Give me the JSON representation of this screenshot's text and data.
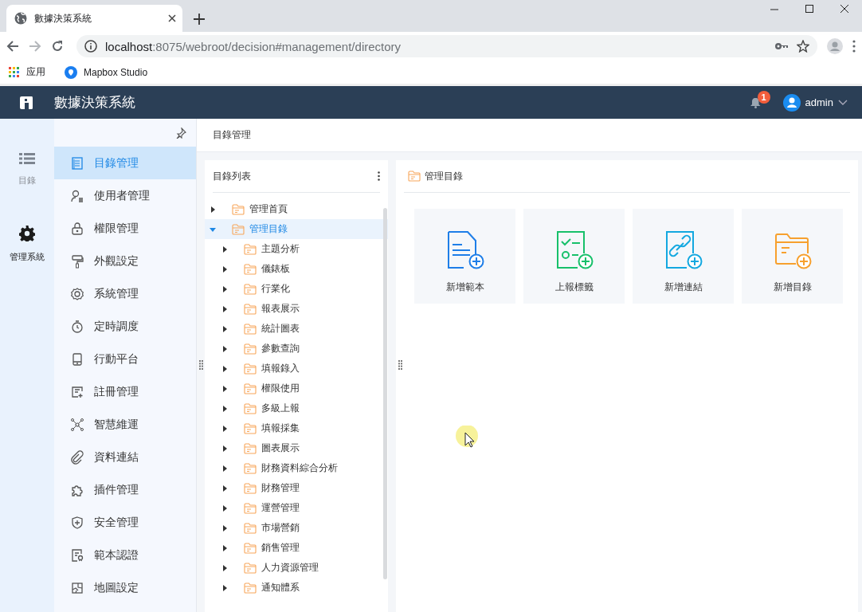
{
  "browser": {
    "tab_title": "數據決策系統",
    "url_host": "localhost",
    "url_rest": ":8075/webroot/decision#management/directory",
    "bookmarks": [
      {
        "label": "应用"
      },
      {
        "label": "Mapbox Studio"
      }
    ]
  },
  "header": {
    "title": "數據決策系統",
    "notification_count": "1",
    "user": "admin"
  },
  "rail": [
    {
      "label": "目錄",
      "selected": false
    },
    {
      "label": "管理系統",
      "selected": true
    }
  ],
  "nav": [
    {
      "label": "目錄管理",
      "selected": true
    },
    {
      "label": "使用者管理",
      "selected": false
    },
    {
      "label": "權限管理",
      "selected": false
    },
    {
      "label": "外觀設定",
      "selected": false
    },
    {
      "label": "系統管理",
      "selected": false
    },
    {
      "label": "定時調度",
      "selected": false
    },
    {
      "label": "行動平台",
      "selected": false
    },
    {
      "label": "註冊管理",
      "selected": false
    },
    {
      "label": "智慧維運",
      "selected": false
    },
    {
      "label": "資料連結",
      "selected": false
    },
    {
      "label": "插件管理",
      "selected": false
    },
    {
      "label": "安全管理",
      "selected": false
    },
    {
      "label": "範本認證",
      "selected": false
    },
    {
      "label": "地圖設定",
      "selected": false
    }
  ],
  "breadcrumb": "目錄管理",
  "tree": {
    "title": "目錄列表",
    "items": [
      {
        "label": "管理首頁",
        "expanded": false,
        "selected": false
      },
      {
        "label": "管理目錄",
        "expanded": true,
        "selected": true,
        "children": [
          {
            "label": "主題分析",
            "expanded": false,
            "selected": false
          },
          {
            "label": "儀錶板",
            "expanded": false,
            "selected": false
          },
          {
            "label": "行業化",
            "expanded": false,
            "selected": false
          },
          {
            "label": "報表展示",
            "expanded": false,
            "selected": false
          },
          {
            "label": "統計圖表",
            "expanded": false,
            "selected": false
          },
          {
            "label": "參數查詢",
            "expanded": false,
            "selected": false
          },
          {
            "label": "填報錄入",
            "expanded": false,
            "selected": false
          },
          {
            "label": "權限使用",
            "expanded": false,
            "selected": false
          },
          {
            "label": "多級上報",
            "expanded": false,
            "selected": false
          },
          {
            "label": "填報採集",
            "expanded": false,
            "selected": false
          },
          {
            "label": "圖表展示",
            "expanded": false,
            "selected": false
          },
          {
            "label": "財務資料綜合分析",
            "expanded": false,
            "selected": false
          },
          {
            "label": "財務管理",
            "expanded": false,
            "selected": false
          },
          {
            "label": "運營管理",
            "expanded": false,
            "selected": false
          },
          {
            "label": "市場營銷",
            "expanded": false,
            "selected": false
          },
          {
            "label": "銷售管理",
            "expanded": false,
            "selected": false
          },
          {
            "label": "人力資源管理",
            "expanded": false,
            "selected": false
          },
          {
            "label": "通知體系",
            "expanded": false,
            "selected": false
          }
        ]
      }
    ]
  },
  "content": {
    "folder": "管理目錄",
    "actions": [
      {
        "label": "新增範本",
        "kind": "template",
        "color": "#1e7ee8"
      },
      {
        "label": "上報標籤",
        "kind": "report",
        "color": "#17c06a"
      },
      {
        "label": "新增連結",
        "kind": "link",
        "color": "#13a8e0"
      },
      {
        "label": "新增目錄",
        "kind": "folder",
        "color": "#f7a02d"
      }
    ]
  }
}
